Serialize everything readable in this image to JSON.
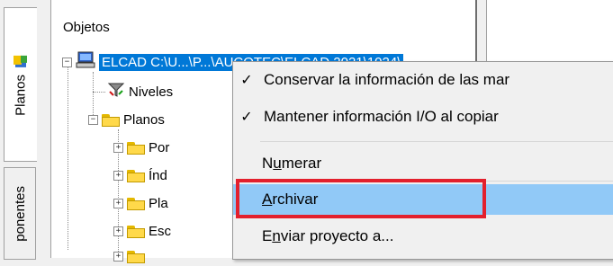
{
  "tabs": [
    {
      "label": "Planos"
    },
    {
      "label": "ponentes"
    }
  ],
  "tree": {
    "header": "Objetos",
    "root": "ELCAD C:\\U...\\P...\\AUCOTEC\\ELCAD 2021\\1024\\",
    "items": [
      {
        "label": "Niveles"
      },
      {
        "label": "Planos"
      },
      {
        "label": "Por"
      },
      {
        "label": "Índ"
      },
      {
        "label": "Pla"
      },
      {
        "label": "Esc"
      }
    ]
  },
  "context_menu": {
    "items": [
      {
        "label": "Conservar la información de las mar",
        "checked": "✓"
      },
      {
        "label": "Mantener información I/O al copiar",
        "checked": "✓"
      },
      {
        "label_pre": "N",
        "label_acc": "u",
        "label_post": "merar"
      },
      {
        "label_acc": "A",
        "label_post": "rchivar"
      },
      {
        "label_pre": "E",
        "label_acc": "n",
        "label_post": "viar proyecto a..."
      }
    ]
  },
  "colors": {
    "highlight": "#91c9f7",
    "selection": "#0078d7",
    "callout": "#e3202d"
  }
}
